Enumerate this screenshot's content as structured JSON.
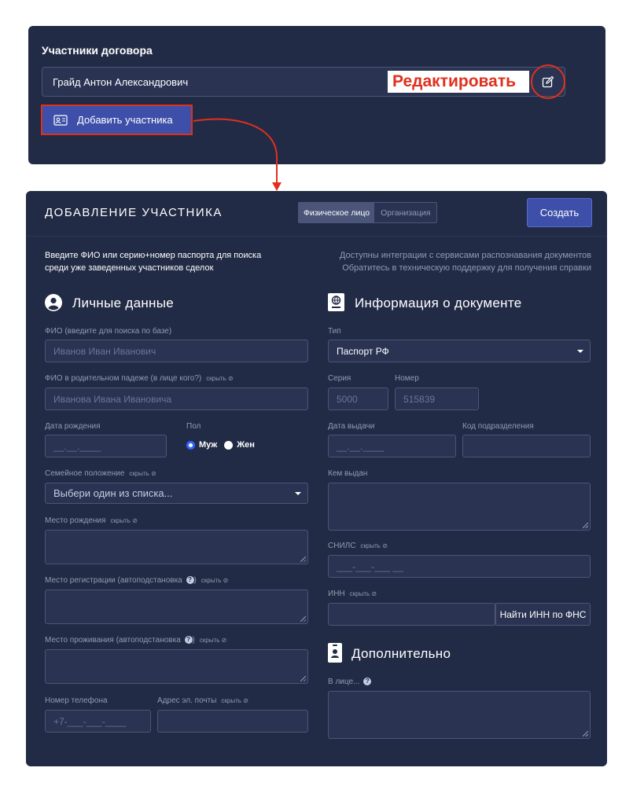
{
  "participants": {
    "title": "Участники договора",
    "participant_name": "Грайд Антон Александрович",
    "edit_label": "Редактировать",
    "add_button": "Добавить участника"
  },
  "form": {
    "title": "ДОБАВЛЕНИЕ УЧАСТНИКА",
    "tabs": [
      "Физическое лицо",
      "Организация"
    ],
    "active_tab": "Физическое лицо",
    "create_button": "Создать",
    "hint_left": [
      "Введите ФИО или серию+номер паспорта для поиска",
      "среди уже заведенных участников сделок"
    ],
    "hint_right": [
      "Доступны интеграции с сервисами распознавания документов",
      "Обратитесь в техническую поддержку для получения справки"
    ],
    "hide_label": "скрыть",
    "personal": {
      "title": "Личные данные",
      "fio_label": "ФИО (введите для поиска по базе)",
      "fio_placeholder": "Иванов Иван Иванович",
      "fio_gen_label": "ФИО в родительном падеже (в лице кого?)",
      "fio_gen_placeholder": "Иванова Ивана Ивановича",
      "birth_date_label": "Дата рождения",
      "birth_date_placeholder": "__.__.____",
      "gender_label": "Пол",
      "gender_options": [
        "Муж",
        "Жен"
      ],
      "gender_selected": "Муж",
      "marital_label": "Семейное положение",
      "marital_placeholder": "Выбери один из списка...",
      "birthplace_label": "Место рождения",
      "registration_label": "Место регистрации (автоподстановка",
      "residence_label": "Место проживания (автоподстановка",
      "phone_label": "Номер телефона",
      "phone_placeholder": "+7-___-___-____",
      "email_label": "Адрес эл. почты"
    },
    "document": {
      "title": "Информация о документе",
      "type_label": "Тип",
      "type_value": "Паспорт РФ",
      "series_label": "Серия",
      "series_placeholder": "5000",
      "number_label": "Номер",
      "number_placeholder": "515839",
      "issue_date_label": "Дата выдачи",
      "issue_date_placeholder": "__.__.____",
      "division_code_label": "Код подразделения",
      "issued_by_label": "Кем выдан",
      "snils_label": "СНИЛС",
      "snils_placeholder": "___-___-___ __",
      "inn_label": "ИНН",
      "inn_button": "Найти ИНН по ФНС"
    },
    "additional": {
      "title": "Дополнительно",
      "in_person_label": "В лице..."
    }
  },
  "colors": {
    "panel_bg": "#222b45",
    "input_bg": "#2a3352",
    "input_border": "#4b5578",
    "primary": "#3d4fa8",
    "annotation_red": "#e0301e"
  }
}
